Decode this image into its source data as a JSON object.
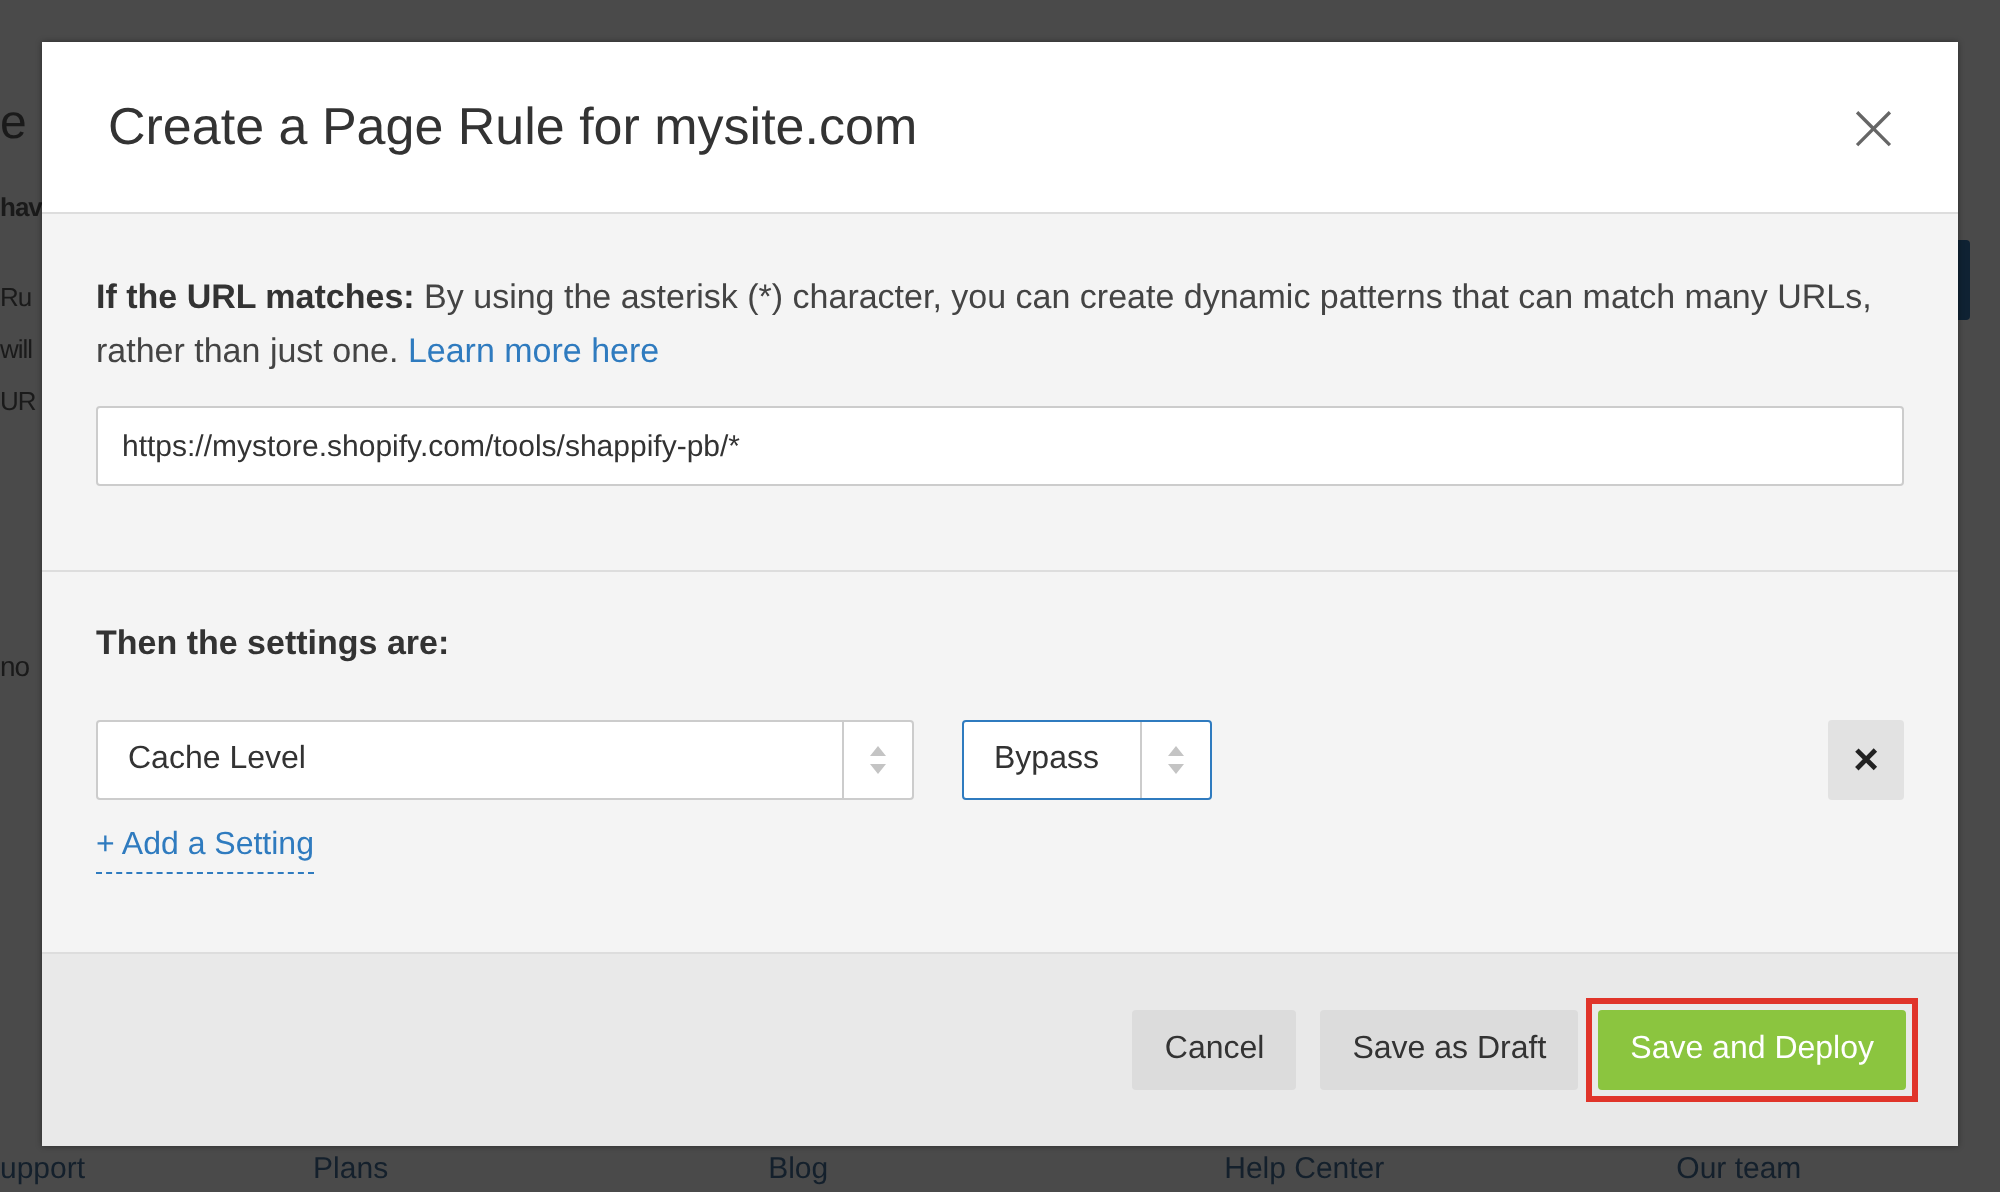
{
  "background": {
    "texts": [
      {
        "text": "e",
        "kind": "heading"
      },
      {
        "text": "hav",
        "kind": "bold"
      },
      {
        "text": "Ru",
        "kind": "line"
      },
      {
        "text": "will",
        "kind": "line"
      },
      {
        "text": "UR",
        "kind": "line"
      },
      {
        "text": "no",
        "kind": "row"
      }
    ],
    "footer_links": [
      "upport",
      "Plans",
      "Blog",
      "Help Center",
      "Our team"
    ]
  },
  "dialog": {
    "title": "Create a Page Rule for mysite.com",
    "close": "×",
    "url_section": {
      "label": "If the URL matches:",
      "description": "By using the asterisk (*) character, you can create dynamic patterns that can match many URLs, rather than just one.",
      "link": "Learn more here",
      "url_value": "https://mystore.shopify.com/tools/shappify-pb/*"
    },
    "settings_section": {
      "heading": "Then the settings are:",
      "settings": [
        {
          "setting": "Cache Level",
          "value": "Bypass",
          "value_focused": true,
          "remove": "×"
        }
      ],
      "add_link": "+ Add a Setting"
    },
    "buttons": [
      {
        "label": "Cancel",
        "kind": "secondary",
        "highlighted": false
      },
      {
        "label": "Save as Draft",
        "kind": "secondary",
        "highlighted": false
      },
      {
        "label": "Save and Deploy",
        "kind": "primary",
        "highlighted": true
      }
    ]
  }
}
